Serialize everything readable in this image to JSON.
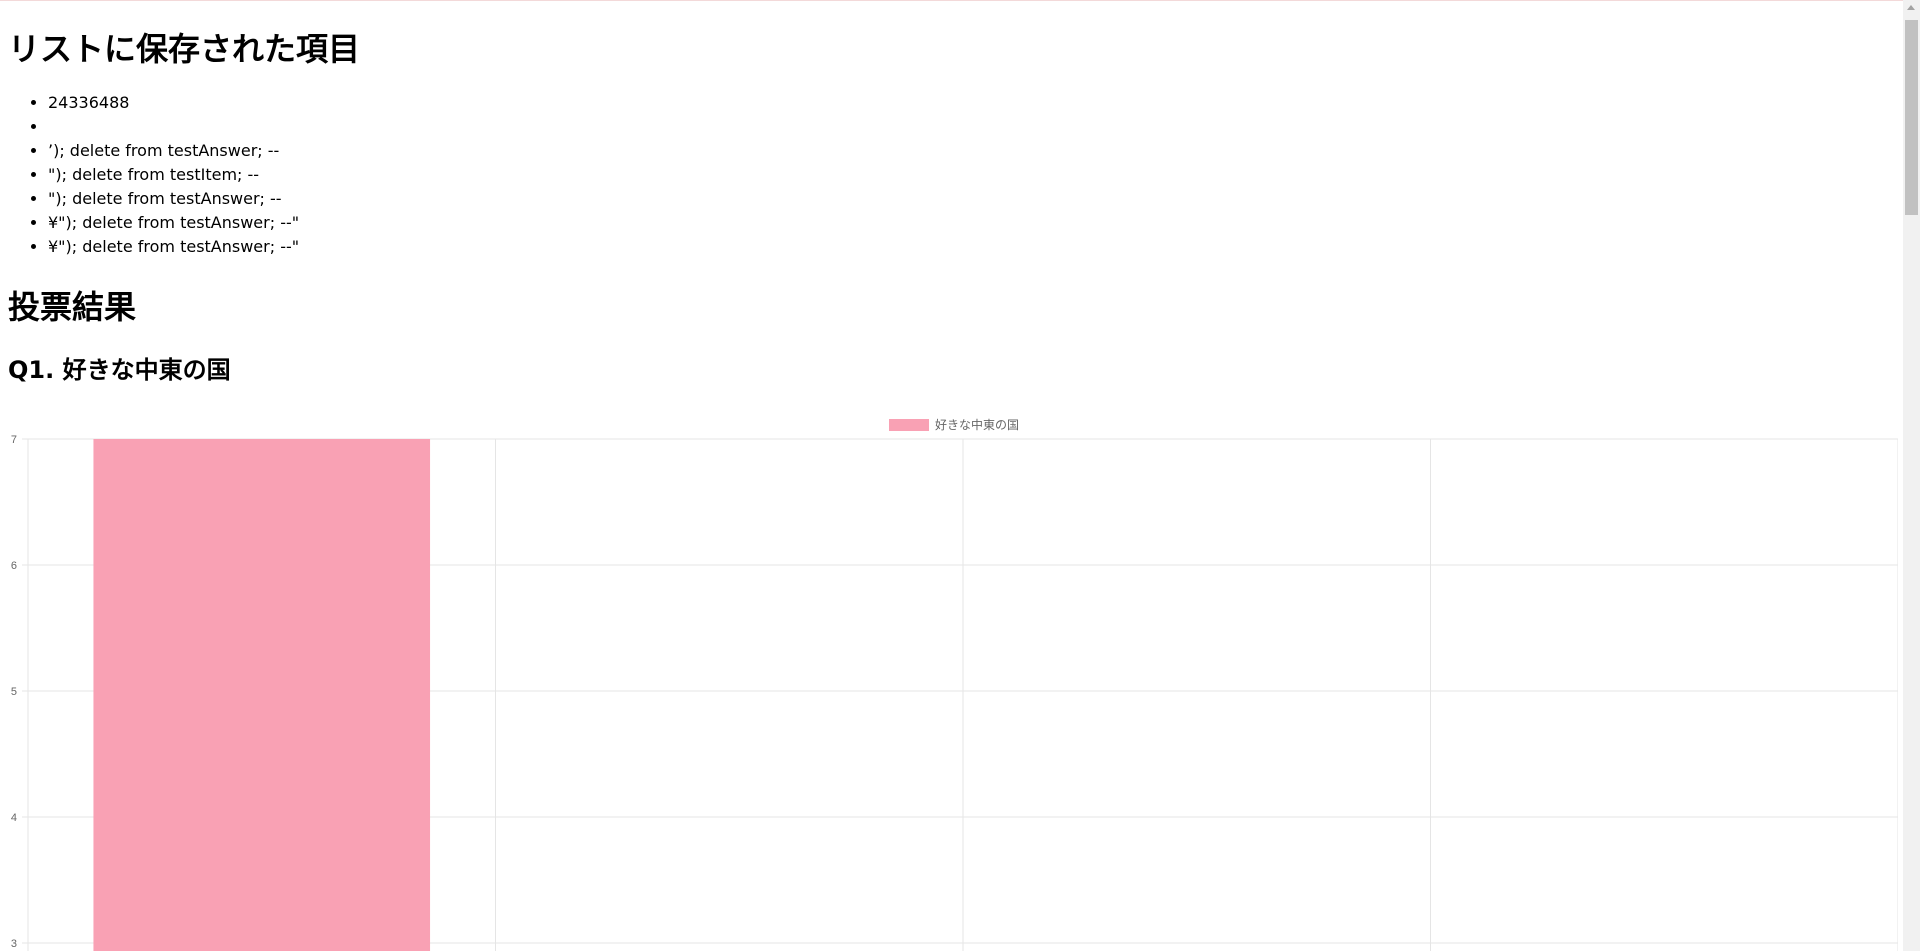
{
  "list_section": {
    "title": "リストに保存された項目",
    "items": [
      "24336488",
      "",
      "’); delete from testAnswer; --",
      "\"); delete from testItem; --",
      "\"); delete from testAnswer; --",
      "¥\"); delete from testAnswer; --\"",
      "¥\"); delete from testAnswer; --\""
    ]
  },
  "results_section": {
    "title": "投票結果",
    "question_title": "Q1. 好きな中東の国"
  },
  "chart_data": {
    "type": "bar",
    "series": [
      {
        "name": "好きな中東の国",
        "values": [
          7,
          0,
          0,
          0
        ]
      }
    ],
    "y_ticks": [
      "7",
      "6",
      "5",
      "4",
      "3"
    ],
    "ylim_visible": [
      3,
      7
    ],
    "grid": true,
    "legend": "top-center",
    "colors": {
      "bar_fill": "#f9a1b4",
      "grid": "#e5e5e5",
      "tick_text": "#666666"
    }
  }
}
